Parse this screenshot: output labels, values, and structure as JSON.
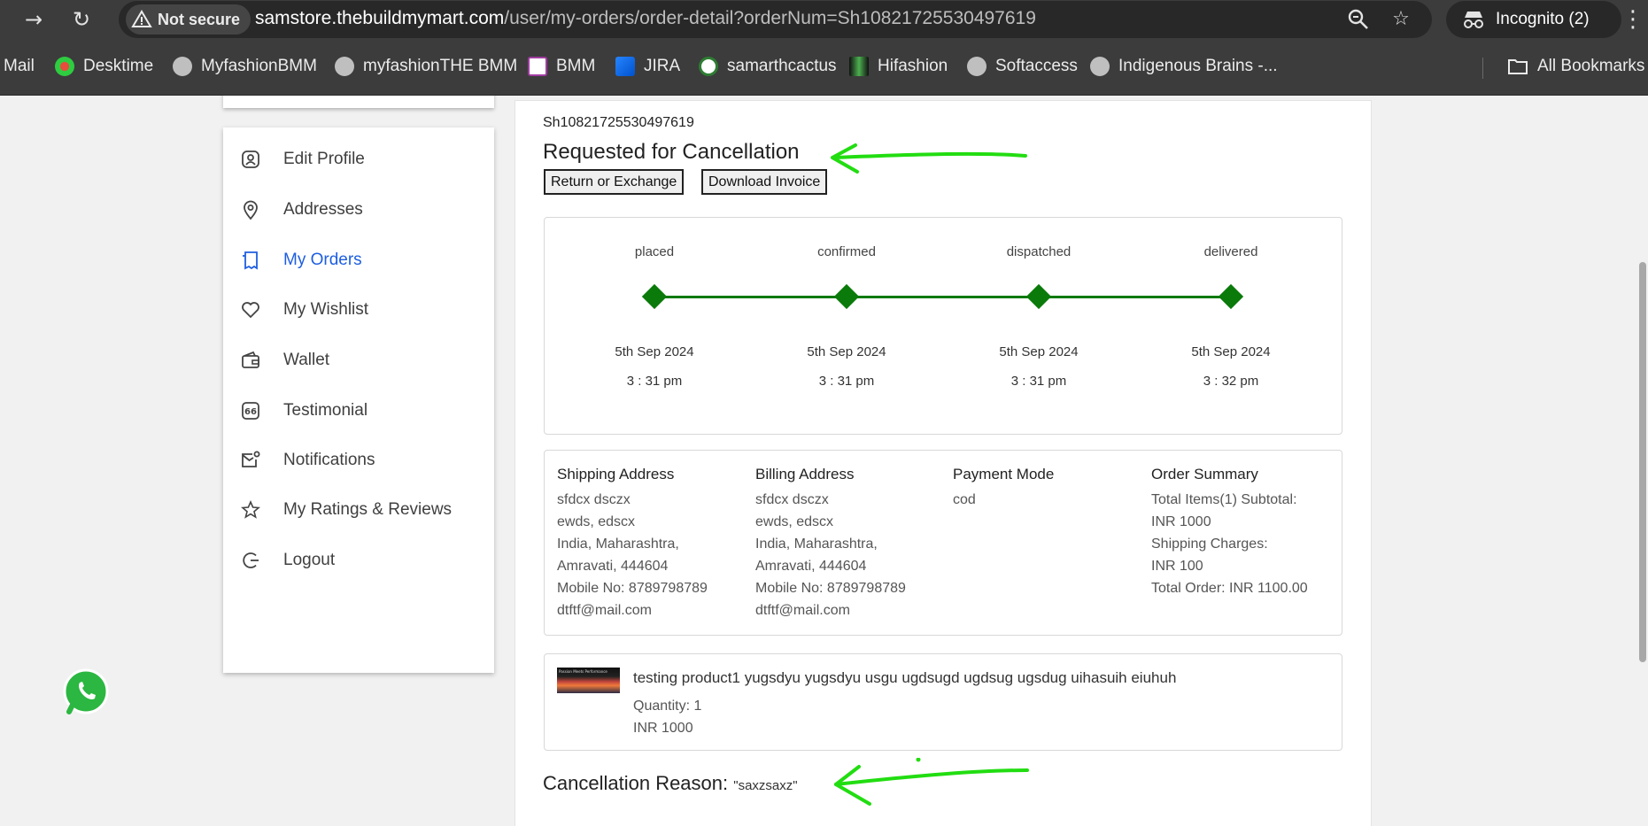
{
  "browser": {
    "security_label": "Not secure",
    "url_host": "samstore.thebuildmymart.com",
    "url_path": "/user/my-orders/order-detail?orderNum=Sh10821725530497619",
    "incognito_label": "Incognito (2)",
    "bookmarks": [
      {
        "label": "Mail",
        "icon": "mail-favicon"
      },
      {
        "label": "Desktime",
        "icon": "desktime-favicon"
      },
      {
        "label": "MyfashionBMM",
        "icon": "globe-icon"
      },
      {
        "label": "myfashionTHE BMM",
        "icon": "globe-icon"
      },
      {
        "label": "BMM",
        "icon": "bmm-favicon"
      },
      {
        "label": "JIRA",
        "icon": "jira-icon"
      },
      {
        "label": "samarthcactus",
        "icon": "cactus-favicon"
      },
      {
        "label": "Hifashion",
        "icon": "hifashion-favicon"
      },
      {
        "label": "Softaccess",
        "icon": "globe-icon"
      },
      {
        "label": "Indigenous Brains -...",
        "icon": "globe-icon"
      }
    ],
    "all_bookmarks_label": "All Bookmarks"
  },
  "sidebar": {
    "items": [
      {
        "label": "Edit Profile",
        "icon": "user-icon"
      },
      {
        "label": "Addresses",
        "icon": "location-pin-icon"
      },
      {
        "label": "My Orders",
        "icon": "orders-icon",
        "active": true
      },
      {
        "label": "My Wishlist",
        "icon": "heart-icon"
      },
      {
        "label": "Wallet",
        "icon": "wallet-icon"
      },
      {
        "label": "Testimonial",
        "icon": "quote-icon"
      },
      {
        "label": "Notifications",
        "icon": "mail-notification-icon"
      },
      {
        "label": "My Ratings & Reviews",
        "icon": "star-icon"
      },
      {
        "label": "Logout",
        "icon": "logout-icon"
      }
    ],
    "active_color": "#1e5ee0"
  },
  "order": {
    "number": "Sh10821725530497619",
    "status": "Requested for Cancellation",
    "return_button": "Return or Exchange",
    "invoice_button": "Download Invoice",
    "tracking": [
      {
        "stage": "placed",
        "date": "5th Sep 2024",
        "time": "3 : 31 pm"
      },
      {
        "stage": "confirmed",
        "date": "5th Sep 2024",
        "time": "3 : 31 pm"
      },
      {
        "stage": "dispatched",
        "date": "5th Sep 2024",
        "time": "3 : 31 pm"
      },
      {
        "stage": "delivered",
        "date": "5th Sep 2024",
        "time": "3 : 32 pm"
      }
    ],
    "track_color": "#0a7a0a",
    "shipping": {
      "heading": "Shipping Address",
      "lines": [
        "sfdcx dsczx",
        "ewds, edscx",
        "India, Maharashtra,",
        "Amravati, 444604",
        "Mobile No: 8789798789",
        "dtftf@mail.com"
      ]
    },
    "billing": {
      "heading": "Billing Address",
      "lines": [
        "sfdcx dsczx",
        "ewds, edscx",
        "India, Maharashtra,",
        "Amravati, 444604",
        "Mobile No: 8789798789",
        "dtftf@mail.com"
      ]
    },
    "payment": {
      "heading": "Payment Mode",
      "value": "cod"
    },
    "summary": {
      "heading": "Order Summary",
      "lines": [
        "Total Items(1) Subtotal:",
        "INR 1000",
        "Shipping Charges:",
        "INR 100",
        "Total Order: INR 1100.00"
      ]
    },
    "product": {
      "name": "testing product1 yugsdyu yugsdyu usgu ugdsugd ugdsug ugsdug uihasuih eiuhuh",
      "quantity": "Quantity: 1",
      "price": "INR 1000",
      "thumbnail_caption": "Passion Meets Performance"
    },
    "cancellation": {
      "label": "Cancellation Reason:",
      "value": "\"saxzsaxz\""
    }
  },
  "annotation_color": "#22dd11"
}
